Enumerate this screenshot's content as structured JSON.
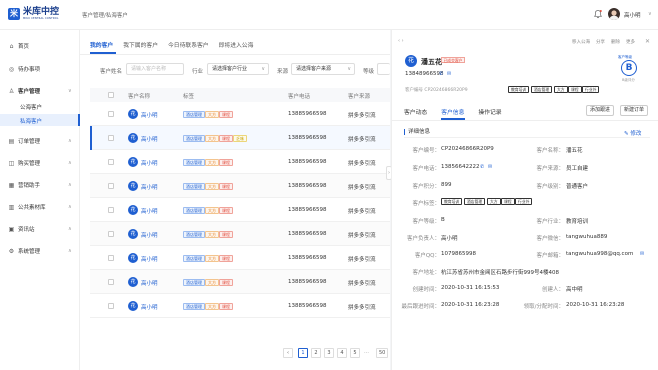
{
  "app": {
    "logo_mark": "米",
    "logo_name": "米库中控",
    "logo_sub": "MIKU CENTRAL CONTROL",
    "breadcrumb": "客户管理/私海客户",
    "username": "高小明"
  },
  "sidebar": {
    "items": [
      {
        "label": "首页",
        "icon": "⌂",
        "chev": ""
      },
      {
        "label": "待办事项",
        "icon": "◎",
        "chev": ""
      },
      {
        "label": "客户管理",
        "icon": "♙",
        "chev": "∨"
      },
      {
        "label": "订单管理",
        "icon": "▤",
        "chev": "∧"
      },
      {
        "label": "购买管理",
        "icon": "◫",
        "chev": "∧"
      },
      {
        "label": "营销助手",
        "icon": "▦",
        "chev": "∧"
      },
      {
        "label": "公共素材库",
        "icon": "▥",
        "chev": "∧"
      },
      {
        "label": "资讯站",
        "icon": "▣",
        "chev": "∧"
      },
      {
        "label": "系统管理",
        "icon": "⚙",
        "chev": "∧"
      }
    ],
    "sub_items": [
      "公海客户",
      "私海客户"
    ]
  },
  "main": {
    "tabs": [
      "我的客户",
      "我下属的客户",
      "今日待联系客户",
      "即将进入公海"
    ],
    "filters": {
      "name_label": "客户姓名",
      "name_placeholder": "请输入客户名称",
      "industry_label": "行业",
      "industry_value": "请选择客户行业",
      "source_label": "来源",
      "source_value": "请选择客户来源",
      "level_label": "等级"
    },
    "columns": [
      "客户名称",
      "标签",
      "客户电话",
      "客户来源"
    ],
    "rows": [
      {
        "name": "高小明",
        "avatar": "花",
        "tags": [
          "酒店管理",
          "大方",
          "课程"
        ],
        "phone": "13885966598",
        "source": "拼多多引流"
      },
      {
        "name": "高小明",
        "avatar": "花",
        "tags": [
          "酒店管理",
          "大方",
          "课程",
          "乏味"
        ],
        "phone": "13885966598",
        "source": "拼多多引流"
      },
      {
        "name": "高小明",
        "avatar": "花",
        "tags": [
          "酒店管理",
          "大方",
          "课程"
        ],
        "phone": "13885966598",
        "source": "拼多多引流"
      },
      {
        "name": "高小明",
        "avatar": "花",
        "tags": [
          "酒店管理",
          "大方",
          "课程"
        ],
        "phone": "13885966598",
        "source": "拼多多引流"
      },
      {
        "name": "高小明",
        "avatar": "花",
        "tags": [
          "酒店管理",
          "大方",
          "课程"
        ],
        "phone": "13885966598",
        "source": "拼多多引流"
      },
      {
        "name": "高小明",
        "avatar": "花",
        "tags": [
          "酒店管理",
          "大方",
          "课程"
        ],
        "phone": "13885966598",
        "source": "拼多多引流"
      },
      {
        "name": "高小明",
        "avatar": "花",
        "tags": [
          "酒店管理",
          "大方",
          "课程"
        ],
        "phone": "13885966598",
        "source": "拼多多引流"
      },
      {
        "name": "高小明",
        "avatar": "花",
        "tags": [
          "酒店管理",
          "大方",
          "课程"
        ],
        "phone": "13885966598",
        "source": "拼多多引流"
      },
      {
        "name": "高小明",
        "avatar": "花",
        "tags": [
          "酒店管理",
          "大方",
          "课程"
        ],
        "phone": "13885966598",
        "source": "拼多多引流"
      }
    ],
    "pagination": {
      "prev": "‹",
      "pages": [
        "1",
        "2",
        "3",
        "4",
        "5"
      ],
      "ellipsis": "…",
      "last": "50"
    }
  },
  "detail": {
    "nav": "‹  ›",
    "actions": [
      "移入公海",
      "分享",
      "删除",
      "更多"
    ],
    "close": "✕",
    "avatar": "花",
    "name": "潘五花",
    "badge": "已成交客户",
    "phone": "13848966598",
    "level_top": "客户等级",
    "level": "B",
    "level_bot": "B级评分",
    "code": "客户编号 CP20246866R20P9",
    "tags": [
      "教育培训",
      "酒店管理",
      "大方",
      "课程",
      "行业外"
    ],
    "tabs": [
      "客户动态",
      "客户信息",
      "操作记录"
    ],
    "buttons": [
      "添加跟进",
      "新建订单"
    ],
    "section_title": "详细信息",
    "edit_label": "修改",
    "fields": {
      "code_label": "客户编号：",
      "code_value": "CP20246866R20P9",
      "name_label": "客户名称：",
      "name_value": "潘五花",
      "phone_label": "客户电话：",
      "phone_value": "13856642222",
      "source_label": "客户来源：",
      "source_value": "员工自建",
      "score_label": "客户积分：",
      "score_value": "899",
      "level_label": "客户级别：",
      "level_value": "普通客户",
      "tags_label": "客户标签：",
      "grade_label": "客户等级：",
      "grade_value": "B",
      "industry_label": "客户行业：",
      "industry_value": "教育培训",
      "owner_label": "客户负责人：",
      "owner_value": "高小明",
      "wechat_label": "客户微信：",
      "wechat_value": "tangwuhua889",
      "qq_label": "客户QQ：",
      "qq_value": "1079865998",
      "email_label": "客户邮箱：",
      "email_value": "tangwuhua998@qq.com",
      "address_label": "客户地址：",
      "address_value": "杭江苏省苏州市金阊区石路步行街999号4楼408",
      "created_label": "创建时间：",
      "created_value": "2020-10-31 16:15:53",
      "creator_label": "创建人：",
      "creator_value": "高中明",
      "followup_label": "最后跟进时间：",
      "followup_value": "2020-10-31 16:23:28",
      "claim_label": "领取/分配时间：",
      "claim_value": "2020-10-31 16:23:28"
    }
  },
  "colors": {
    "accent": "#1f5fd1"
  }
}
